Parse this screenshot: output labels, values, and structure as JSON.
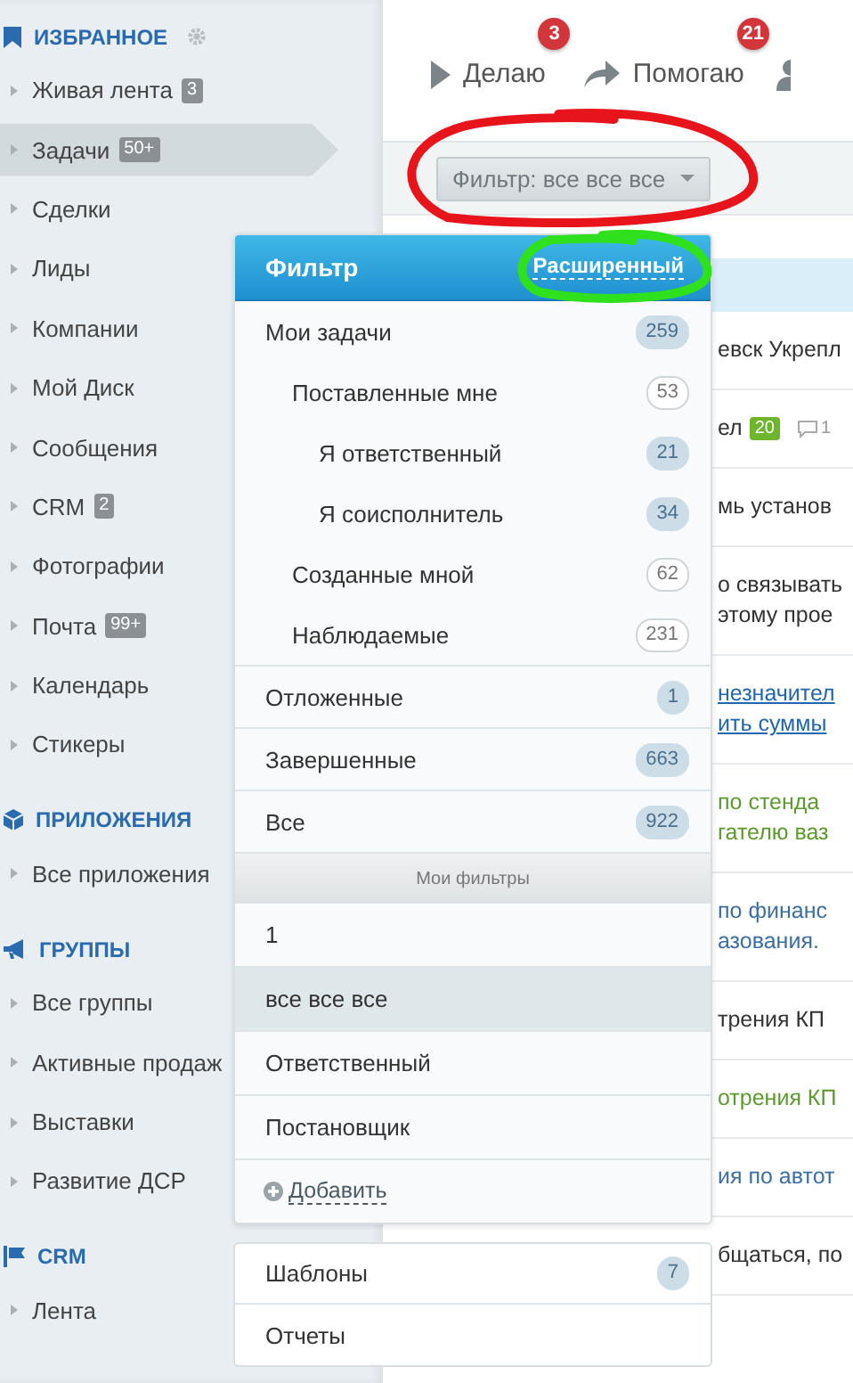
{
  "sidebar": {
    "sections": [
      {
        "title": "ИЗБРАННОЕ",
        "settings": true,
        "items": [
          {
            "label": "Живая лента",
            "counter": "3",
            "selected": false
          },
          {
            "label": "Задачи",
            "counter": "50+",
            "selected": true
          },
          {
            "label": "Сделки",
            "selected": false
          },
          {
            "label": "Лиды",
            "selected": false
          },
          {
            "label": "Компании",
            "selected": false
          },
          {
            "label": "Мой Диск",
            "selected": false
          },
          {
            "label": "Сообщения",
            "selected": false
          },
          {
            "label": "CRM",
            "counter": "2",
            "selected": false
          },
          {
            "label": "Фотографии",
            "selected": false
          },
          {
            "label": "Почта",
            "counter": "99+",
            "selected": false
          },
          {
            "label": "Календарь",
            "selected": false
          },
          {
            "label": "Стикеры",
            "selected": false
          }
        ]
      },
      {
        "title": "ПРИЛОЖЕНИЯ",
        "settings": false,
        "items": [
          {
            "label": "Все приложения",
            "selected": false
          }
        ]
      },
      {
        "title": "ГРУППЫ",
        "settings": false,
        "items": [
          {
            "label": "Все группы",
            "selected": false
          },
          {
            "label": "Активные продаж",
            "selected": false
          },
          {
            "label": "Выставки",
            "selected": false
          },
          {
            "label": "Развитие ДСР",
            "selected": false
          }
        ]
      },
      {
        "title": "CRM",
        "settings": false,
        "items": [
          {
            "label": "Лента",
            "selected": false
          }
        ]
      }
    ]
  },
  "topbar": {
    "tabs": [
      {
        "label": "Делаю",
        "badge": "3"
      },
      {
        "label": "Помогаю",
        "badge": "21"
      },
      {
        "kind": "icon-only"
      }
    ]
  },
  "filter_button": {
    "label": "Фильтр: все все все"
  },
  "filter_popup": {
    "title": "Фильтр",
    "mode_link": "Расширенный",
    "groups": [
      {
        "items": [
          {
            "label": "Мои задачи",
            "count": "259",
            "outlined": false,
            "children": [
              {
                "label": "Поставленные мне",
                "count": "53",
                "outlined": true,
                "children": [
                  {
                    "label": "Я ответственный",
                    "count": "21",
                    "outlined": false
                  },
                  {
                    "label": "Я соисполнитель",
                    "count": "34",
                    "outlined": false
                  }
                ]
              },
              {
                "label": "Созданные мной",
                "count": "62",
                "outlined": true
              },
              {
                "label": "Наблюдаемые",
                "count": "231",
                "outlined": true
              }
            ]
          }
        ]
      },
      {
        "items": [
          {
            "label": "Отложенные",
            "count": "1",
            "outlined": false
          }
        ]
      },
      {
        "items": [
          {
            "label": "Завершенные",
            "count": "663",
            "outlined": false
          }
        ]
      },
      {
        "items": [
          {
            "label": "Все",
            "count": "922",
            "outlined": false
          }
        ]
      }
    ],
    "my_filters": {
      "title": "Мои фильтры",
      "items": [
        {
          "label": "1",
          "selected": false
        },
        {
          "label": "все все все",
          "selected": true
        },
        {
          "label": "Ответственный",
          "selected": false
        },
        {
          "label": "Постановщик",
          "selected": false
        }
      ],
      "add_label": "Добавить"
    }
  },
  "extra_menu": {
    "items": [
      {
        "label": "Шаблоны",
        "count": "7"
      },
      {
        "label": "Отчеты"
      }
    ]
  },
  "tasks": [
    {
      "kind": "plain",
      "lines": [
        "евск Укрепл"
      ]
    },
    {
      "kind": "plain",
      "lines": [
        "ел"
      ],
      "badge": "20",
      "comments": "1"
    },
    {
      "kind": "plain",
      "lines": [
        "мь установ"
      ]
    },
    {
      "kind": "plain",
      "lines": [
        "о связывать",
        "этому прое"
      ]
    },
    {
      "kind": "link",
      "lines": [
        "незначител",
        "ить суммы"
      ]
    },
    {
      "kind": "success",
      "lines": [
        "по стенда",
        "гателю ваз"
      ]
    },
    {
      "kind": "info",
      "lines": [
        "по финанс",
        "азования."
      ]
    },
    {
      "kind": "plain",
      "lines": [
        "трения КП"
      ]
    },
    {
      "kind": "success",
      "lines": [
        "отрения КП"
      ]
    },
    {
      "kind": "info",
      "lines": [
        "ия по автот"
      ]
    },
    {
      "kind": "plain",
      "lines": [
        "бщаться, по"
      ]
    }
  ],
  "annotations": [
    {
      "kind": "ellipse",
      "color": "#e8141b"
    },
    {
      "kind": "ellipse",
      "color": "#2fe01c"
    }
  ]
}
